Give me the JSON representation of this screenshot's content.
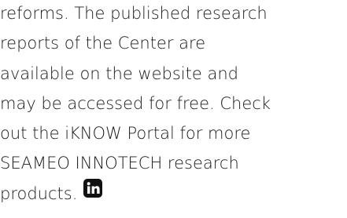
{
  "paragraph": {
    "lines": [
      "reforms. The published research",
      "reports of the Center are",
      "available on the website and",
      "may be accessed for free. Check",
      "out the iKNOW Portal for more",
      "SEAMEO INNOTECH research",
      "products."
    ]
  },
  "icons": {
    "share": "linkedin-icon"
  },
  "colors": {
    "text": "#1a1a1a",
    "icon": "#111111"
  }
}
